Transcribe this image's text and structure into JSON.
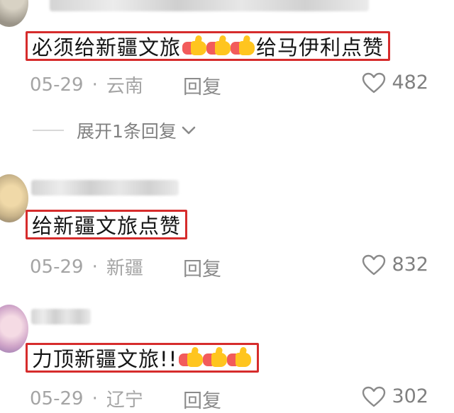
{
  "comments": [
    {
      "content_before": "必须给新疆文旅",
      "thumb_count": 3,
      "content_after": "给马伊利点赞",
      "date": "05-29",
      "location": "云南",
      "reply_label": "回复",
      "likes": "482"
    },
    {
      "content_before": "给新疆文旅点赞",
      "thumb_count": 0,
      "content_after": "",
      "date": "05-29",
      "location": "新疆",
      "reply_label": "回复",
      "likes": "832"
    },
    {
      "content_before": "力顶新疆文旅!!",
      "thumb_count": 3,
      "content_after": "",
      "date": "05-29",
      "location": "辽宁",
      "reply_label": "回复",
      "likes": "302"
    }
  ],
  "expand_replies": {
    "label": "展开1条回复"
  },
  "separator": "·",
  "colors": {
    "highlight_border": "#d62c2c",
    "muted_text": "#a4a4a4",
    "thumb_yellow": "#ffc51f",
    "thumb_cuff": "#f25b5b"
  },
  "icons": {
    "like": "heart-outline-icon",
    "expand": "chevron-down-icon",
    "emoji": "thumbs-up-emoji-icon"
  }
}
